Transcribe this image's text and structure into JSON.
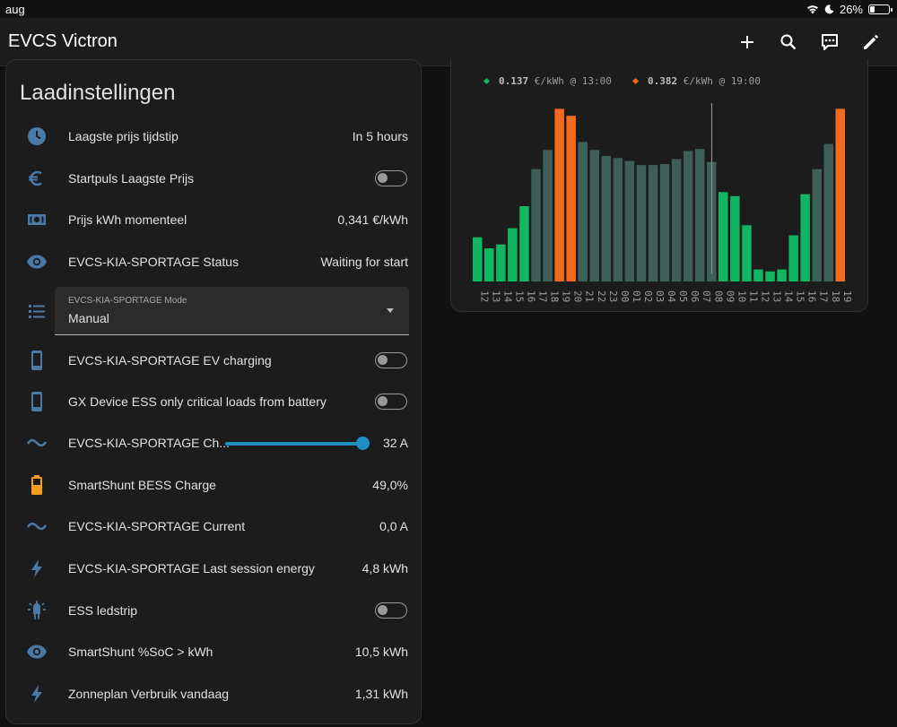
{
  "status": {
    "time": "aug",
    "battery": "26%"
  },
  "app": {
    "title": "EVCS Victron"
  },
  "toolbar": {
    "add_icon": "plus-icon",
    "search_icon": "search-icon",
    "assist_icon": "chat-icon",
    "edit_icon": "pencil-icon"
  },
  "card": {
    "title": "Laadinstellingen",
    "rows": [
      {
        "icon": "clock-icon",
        "label": "Laagste prijs tijdstip",
        "value": "In 5 hours"
      },
      {
        "icon": "euro-icon",
        "label": "Startpuls Laagste Prijs",
        "toggle": "off"
      },
      {
        "icon": "cash-icon",
        "label": "Prijs kWh momenteel",
        "value": "0,341 €/kWh"
      },
      {
        "icon": "eye-icon",
        "label": "EVCS-KIA-SPORTAGE Status",
        "value": "Waiting for start"
      },
      {
        "icon": "list-icon",
        "select_caption": "EVCS-KIA-SPORTAGE Mode",
        "select_value": "Manual"
      },
      {
        "icon": "cellphone-icon",
        "label": "EVCS-KIA-SPORTAGE EV charging",
        "toggle": "off"
      },
      {
        "icon": "cellphone-icon",
        "label": "GX Device ESS only critical loads from battery",
        "toggle": "off"
      },
      {
        "icon": "current-ac-icon",
        "label": "EVCS-KIA-SPORTAGE Ch...",
        "value": "32 A",
        "slider_fraction": 1.0
      },
      {
        "icon": "battery-icon",
        "label": "SmartShunt BESS Charge",
        "value": "49,0%"
      },
      {
        "icon": "current-ac-icon",
        "label": "EVCS-KIA-SPORTAGE Current",
        "value": "0,0 A"
      },
      {
        "icon": "flash-icon",
        "label": "EVCS-KIA-SPORTAGE Last session energy",
        "value": "4,8 kWh"
      },
      {
        "icon": "led-strip-icon",
        "label": "ESS ledstrip",
        "toggle": "off"
      },
      {
        "icon": "eye-icon",
        "label": "SmartShunt %SoC > kWh",
        "value": "10,5 kWh"
      },
      {
        "icon": "flash-icon",
        "label": "Zonneplan Verbruik vandaag",
        "value": "1,31 kWh"
      }
    ]
  },
  "chart_legend": {
    "low": {
      "price": "0.137",
      "unit": "€/kWh @ 13:00"
    },
    "high": {
      "price": "0.382",
      "unit": "€/kWh @ 19:00"
    }
  },
  "colors": {
    "low": "#11b663",
    "high": "#f36a1f",
    "mid": "#3e5e58",
    "accent": "#1e8fc2",
    "icon": "#4b79a6",
    "battery": "#f59c1a"
  },
  "chart_data": {
    "type": "bar",
    "categories": [
      "12",
      "13",
      "14",
      "15",
      "16",
      "17",
      "18",
      "19",
      "20",
      "21",
      "22",
      "23",
      "00",
      "01",
      "02",
      "03",
      "04",
      "05",
      "06",
      "07",
      "08",
      "09",
      "10",
      "11",
      "12",
      "13",
      "14",
      "15",
      "16",
      "17",
      "18",
      "19"
    ],
    "values": [
      0.254,
      0.243,
      0.247,
      0.263,
      0.285,
      0.322,
      0.341,
      0.382,
      0.375,
      0.349,
      0.341,
      0.335,
      0.333,
      0.33,
      0.326,
      0.326,
      0.327,
      0.332,
      0.34,
      0.342,
      0.329,
      0.299,
      0.295,
      0.266,
      0.222,
      0.22,
      0.222,
      0.256,
      0.297,
      0.322,
      0.347,
      0.382
    ],
    "bar_colors": [
      "low",
      "low",
      "low",
      "low",
      "low",
      "mid",
      "mid",
      "high",
      "high",
      "mid",
      "mid",
      "mid",
      "mid",
      "mid",
      "mid",
      "mid",
      "mid",
      "mid",
      "mid",
      "mid",
      "mid",
      "low",
      "low",
      "low",
      "low",
      "low",
      "low",
      "low",
      "low",
      "mid",
      "mid",
      "high"
    ],
    "ylim": [
      0.21,
      0.385
    ],
    "now_index": 20.5,
    "xlabel": "",
    "ylabel": "",
    "title": ""
  }
}
